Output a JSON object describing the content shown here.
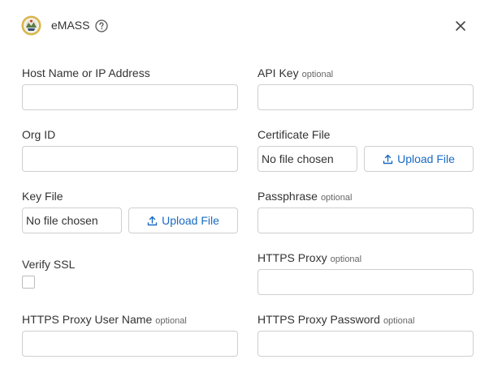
{
  "header": {
    "title": "eMASS",
    "logo_icon": "emass-seal-icon",
    "help_icon": "question-circle-icon",
    "close_icon": "close-icon"
  },
  "form": {
    "optional_text": "optional",
    "host": {
      "label": "Host Name or IP Address",
      "value": ""
    },
    "api_key": {
      "label": "API Key",
      "value": ""
    },
    "org_id": {
      "label": "Org ID",
      "value": ""
    },
    "certificate_file": {
      "label": "Certificate File",
      "file_status": "No file chosen",
      "upload_label": "Upload File"
    },
    "key_file": {
      "label": "Key File",
      "file_status": "No file chosen",
      "upload_label": "Upload File"
    },
    "passphrase": {
      "label": "Passphrase",
      "value": ""
    },
    "verify_ssl": {
      "label": "Verify SSL",
      "checked": false
    },
    "https_proxy": {
      "label": "HTTPS Proxy",
      "value": ""
    },
    "https_proxy_user": {
      "label": "HTTPS Proxy User Name",
      "value": ""
    },
    "https_proxy_password": {
      "label": "HTTPS Proxy Password",
      "value": ""
    }
  },
  "colors": {
    "link_blue": "#1a6ac4",
    "border": "#cfcfcf",
    "text": "#333333"
  }
}
